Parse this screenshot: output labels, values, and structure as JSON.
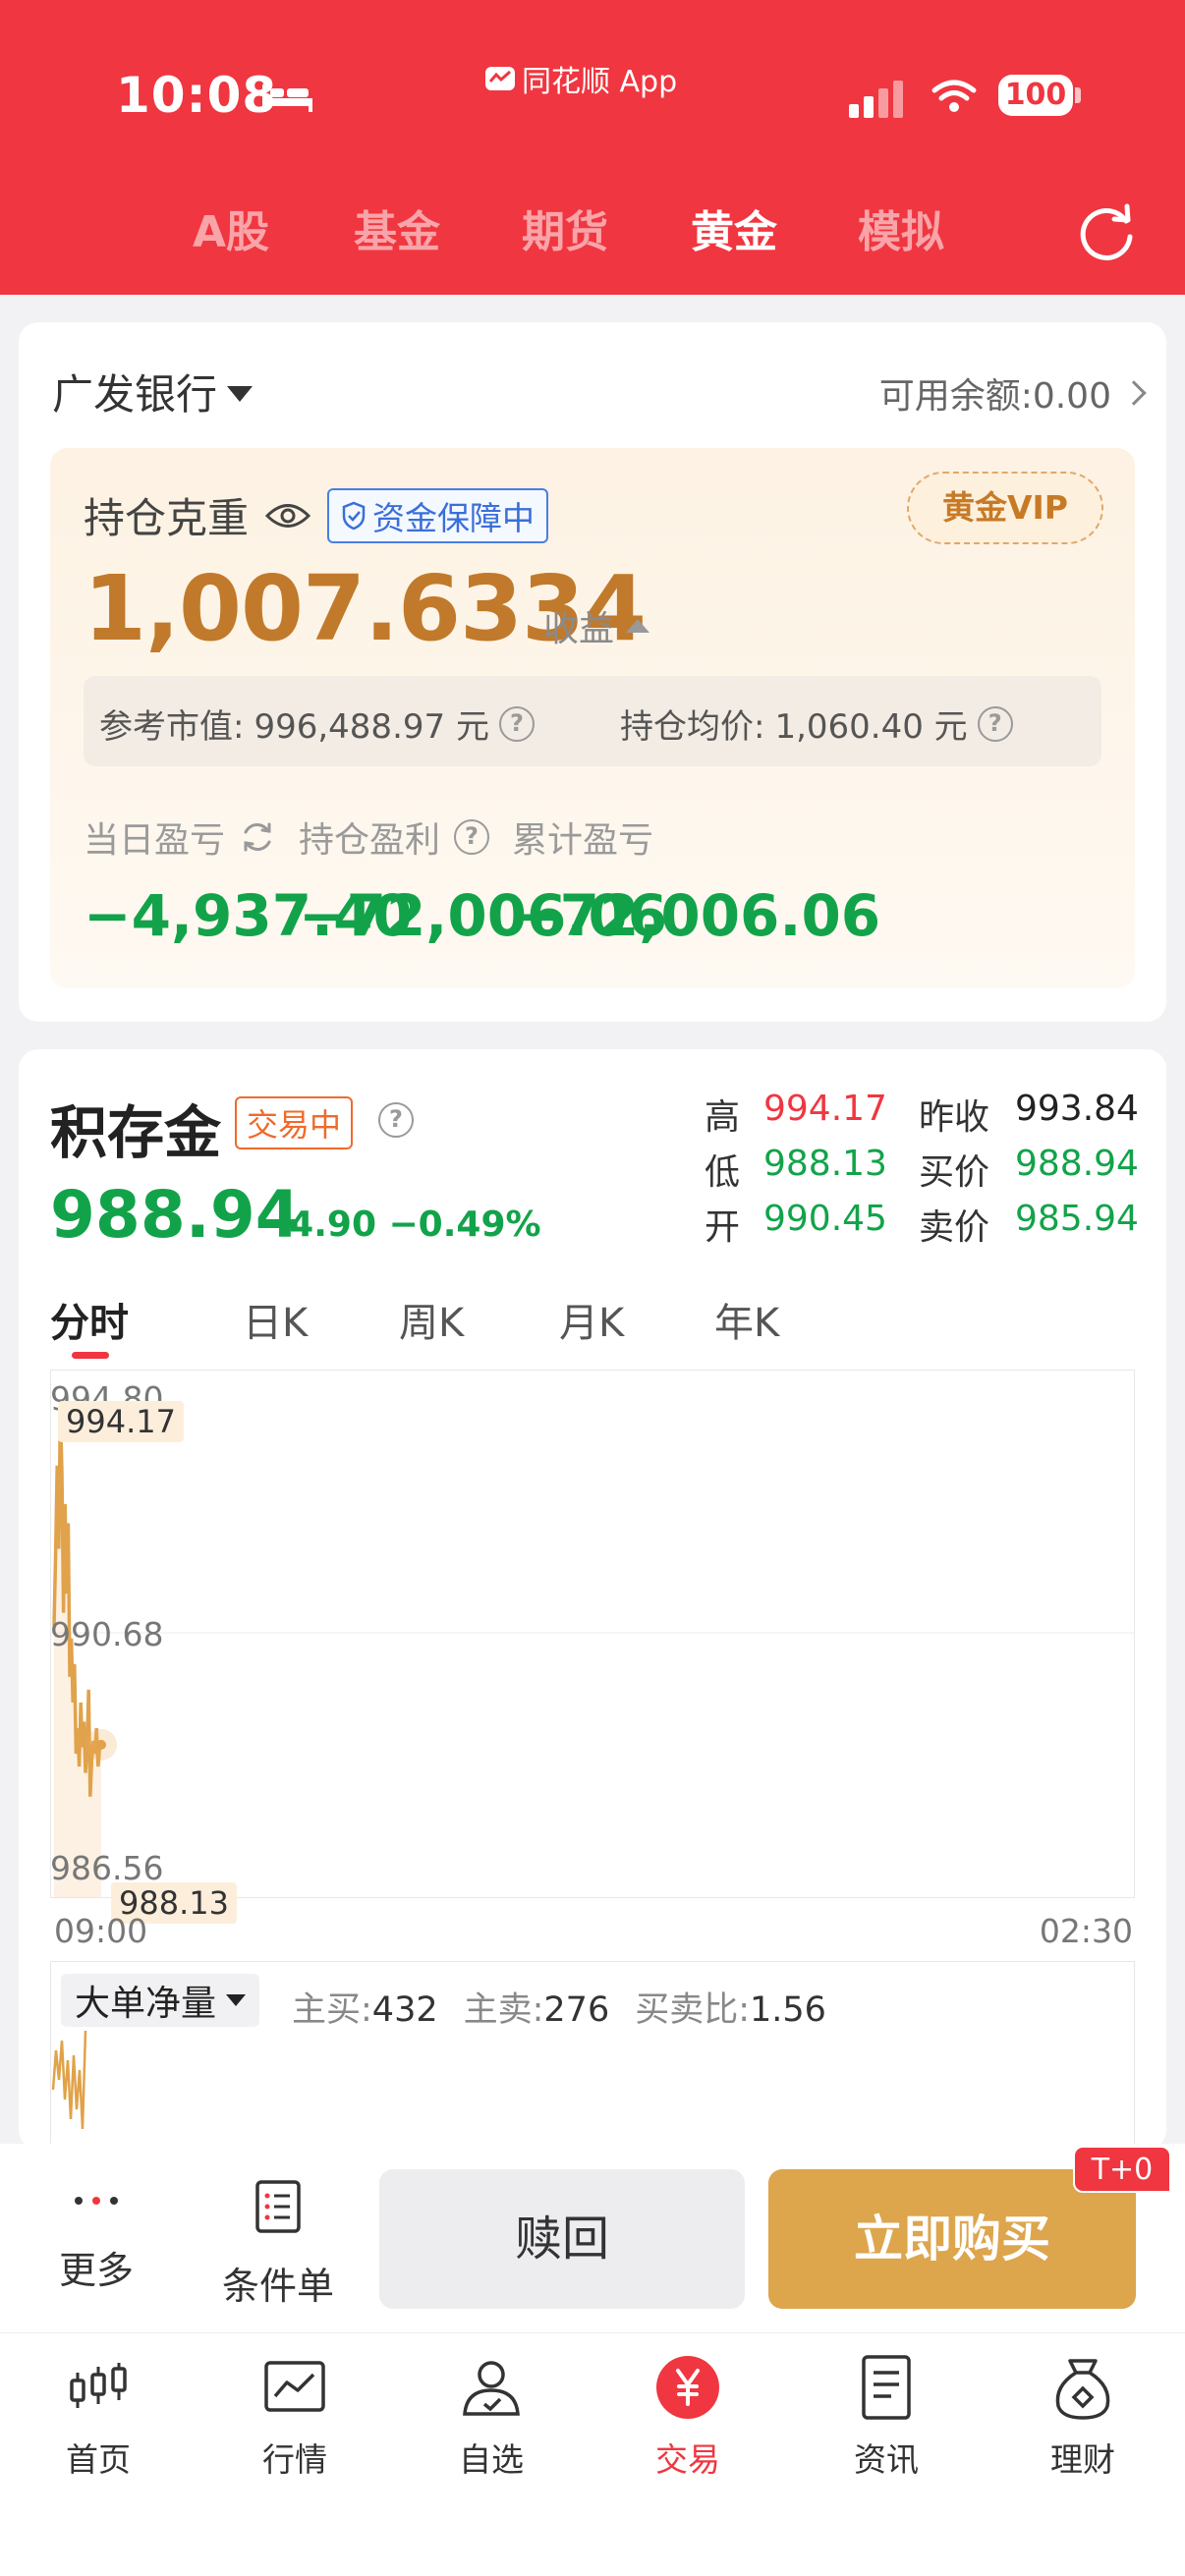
{
  "status_bar": {
    "time": "10:08",
    "app_label": "同花顺 App",
    "battery": "100"
  },
  "top_tabs": [
    {
      "label": "A股",
      "active": false
    },
    {
      "label": "基金",
      "active": false
    },
    {
      "label": "期货",
      "active": false
    },
    {
      "label": "黄金",
      "active": true
    },
    {
      "label": "模拟",
      "active": false
    }
  ],
  "account": {
    "bank": "广发银行",
    "balance": "可用余额:0.00",
    "hold_label": "持仓克重",
    "guarantee": "资金保障中",
    "vip": "黄金VIP",
    "weight": "1,007.6334",
    "income_label": "收益",
    "ref_value_label": "参考市值:",
    "ref_value": "996,488.97 元",
    "avg_price_label": "持仓均价:",
    "avg_price": "1,060.40 元",
    "pnl": [
      {
        "label": "当日盈亏",
        "value": "−4,937.40"
      },
      {
        "label": "持仓盈利",
        "value": "−72,006.06"
      },
      {
        "label": "累计盈亏",
        "value": "−72,006.06"
      }
    ]
  },
  "product": {
    "name": "积存金",
    "status": "交易中",
    "price": "988.94",
    "change": "−4.90 −0.49%",
    "stats": {
      "high_label": "高",
      "high": "994.17",
      "low_label": "低",
      "low": "988.13",
      "open_label": "开",
      "open": "990.45",
      "prev_close_label": "昨收",
      "prev_close": "993.84",
      "bid_label": "买价",
      "bid": "988.94",
      "ask_label": "卖价",
      "ask": "985.94"
    },
    "k_tabs": [
      "分时",
      "日K",
      "周K",
      "月K",
      "年K"
    ],
    "chart": {
      "y_top": "994.80",
      "y_mid": "990.68",
      "y_bottom": "986.56",
      "x_start": "09:00",
      "x_end": "02:30",
      "high_tag": "994.17",
      "low_tag": "988.13"
    },
    "volume": {
      "selector": "大单净量",
      "buy_label": "主买:",
      "buy": "432",
      "sell_label": "主卖:",
      "sell": "276",
      "ratio_label": "买卖比:",
      "ratio": "1.56"
    }
  },
  "chart_data": {
    "type": "line",
    "title": "",
    "xlabel": "",
    "ylabel": "",
    "x_range": [
      "09:00",
      "02:30"
    ],
    "ylim": [
      986.56,
      994.8
    ],
    "series": [
      {
        "values": [
          990.8,
          991.9,
          993.3,
          992.0,
          994.17,
          993.2,
          991.0,
          992.7,
          991.3,
          992.4,
          990.0,
          990.6,
          989.6,
          990.2,
          988.8,
          989.2,
          988.6,
          989.6,
          988.9,
          989.3,
          988.5,
          988.9,
          989.8,
          988.13,
          988.7,
          989.0,
          988.8,
          989.2,
          988.6,
          988.9,
          988.94
        ]
      }
    ]
  },
  "actions": {
    "more": "更多",
    "conditional": "条件单",
    "redeem": "赎回",
    "buy": "立即购买",
    "t0": "T+0"
  },
  "bottom_nav": [
    {
      "label": "首页",
      "icon": "candlestick-icon"
    },
    {
      "label": "行情",
      "icon": "chart-icon"
    },
    {
      "label": "自选",
      "icon": "person-check-icon"
    },
    {
      "label": "交易",
      "icon": "yuan-icon"
    },
    {
      "label": "资讯",
      "icon": "news-icon"
    },
    {
      "label": "理财",
      "icon": "money-bag-icon"
    }
  ],
  "colors": {
    "brand_red": "#f03640",
    "gold": "#c17a2b",
    "down_green": "#12a34a",
    "up_red": "#f03640",
    "line": "#e0a24a"
  }
}
